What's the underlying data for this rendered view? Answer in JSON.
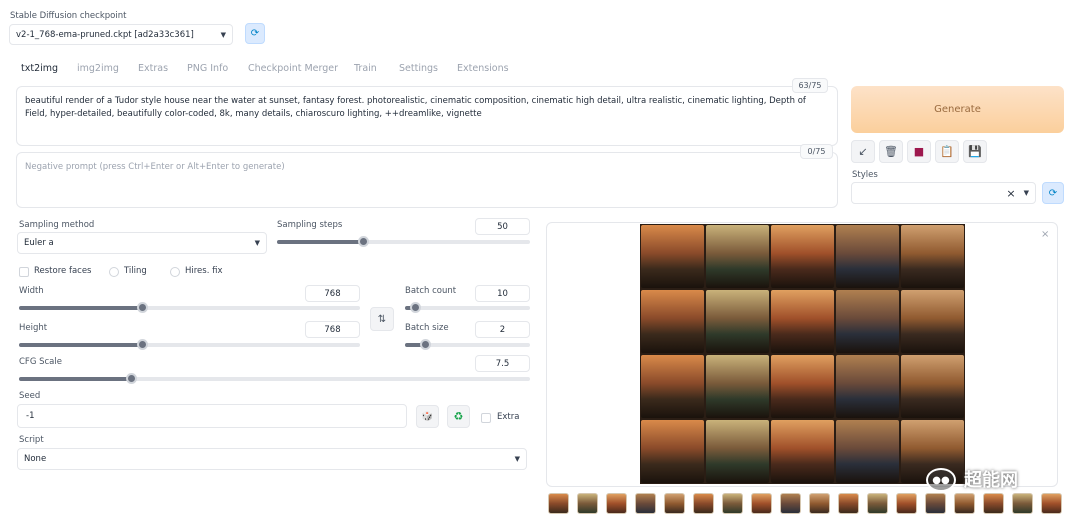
{
  "checkpoint": {
    "label": "Stable Diffusion checkpoint",
    "value": "v2-1_768-ema-pruned.ckpt [ad2a33c361]"
  },
  "tabs": [
    {
      "label": "txt2img"
    },
    {
      "label": "img2img"
    },
    {
      "label": "Extras"
    },
    {
      "label": "PNG Info"
    },
    {
      "label": "Checkpoint Merger"
    },
    {
      "label": "Train"
    },
    {
      "label": "Settings"
    },
    {
      "label": "Extensions"
    }
  ],
  "prompt": {
    "value": "beautiful render of a Tudor style house near the water at sunset, fantasy forest. photorealistic, cinematic composition, cinematic high detail, ultra realistic, cinematic lighting, Depth of Field, hyper-detailed, beautifully color-coded, 8k, many details, chiaroscuro lighting, ++dreamlike, vignette",
    "token_count": "63/75"
  },
  "negative_prompt": {
    "placeholder": "Negative prompt (press Ctrl+Enter or Alt+Enter to generate)",
    "token_count": "0/75"
  },
  "generate_label": "Generate",
  "styles": {
    "label": "Styles",
    "clear": "×"
  },
  "sampling": {
    "method_label": "Sampling method",
    "method_value": "Euler a",
    "steps_label": "Sampling steps",
    "steps_value": "50",
    "steps_fraction": 0.34
  },
  "checkboxes": {
    "restore_faces": "Restore faces",
    "tiling": "Tiling",
    "hires_fix": "Hires. fix"
  },
  "width": {
    "label": "Width",
    "value": "768",
    "fraction": 0.36
  },
  "height": {
    "label": "Height",
    "value": "768",
    "fraction": 0.36
  },
  "batch_count": {
    "label": "Batch count",
    "value": "10",
    "fraction": 0.08
  },
  "batch_size": {
    "label": "Batch size",
    "value": "2",
    "fraction": 0.16
  },
  "cfg": {
    "label": "CFG Scale",
    "value": "7.5",
    "fraction": 0.22
  },
  "seed": {
    "label": "Seed",
    "value": "-1",
    "extra_label": "Extra"
  },
  "script": {
    "label": "Script",
    "value": "None"
  },
  "watermark": "超能网",
  "colors": {
    "generate_start": "#fde2c8",
    "generate_end": "#fbcf9c",
    "slider": "#6b7280",
    "refresh": "#0284c7"
  }
}
